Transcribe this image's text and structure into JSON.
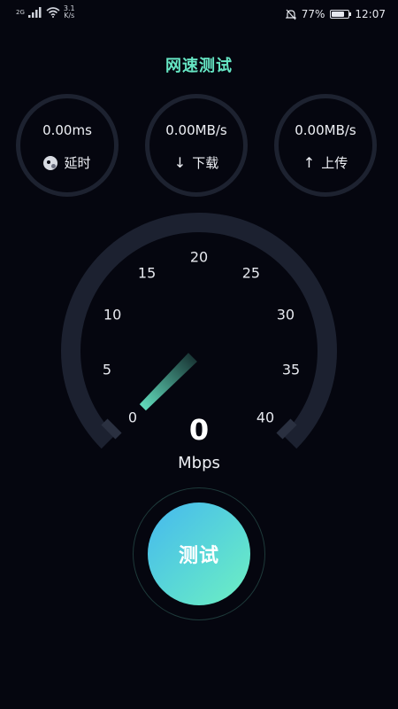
{
  "status_bar": {
    "signal_label": "2G",
    "net_speed_top": "3.1",
    "net_speed_bottom": "K/s",
    "battery_percent": "77%",
    "battery_level": 0.77,
    "time": "12:07",
    "icons": [
      "signal-icon",
      "wifi-icon",
      "mute-icon",
      "battery-icon"
    ]
  },
  "title": "网速测试",
  "stats": {
    "latency": {
      "value": "0.00ms",
      "label": "延时",
      "icon": "latency-icon"
    },
    "download": {
      "value": "0.00MB/s",
      "label": "下载",
      "icon_glyph": "↓"
    },
    "upload": {
      "value": "0.00MB/s",
      "label": "上传",
      "icon_glyph": "↑"
    }
  },
  "gauge": {
    "ticks": [
      "0",
      "5",
      "10",
      "15",
      "20",
      "25",
      "30",
      "35",
      "40"
    ],
    "speed_value": "0",
    "unit": "Mbps",
    "needle_value": 0,
    "colors": {
      "track": "#1c2130",
      "needle": "#66e6c4"
    }
  },
  "test_button": {
    "label": "测试"
  },
  "colors": {
    "background": "#05060f",
    "accent": "#66e6c4"
  }
}
